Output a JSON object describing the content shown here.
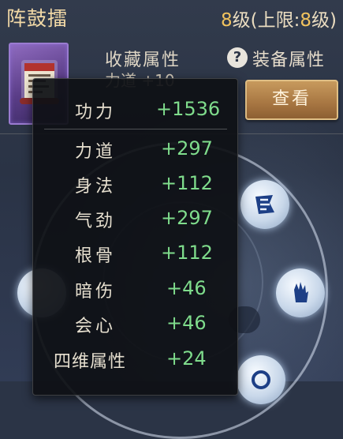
{
  "header": {
    "title": "阵鼓擂",
    "level_prefix": "8",
    "level_mid": "级(上限:",
    "level_max": "8",
    "level_suffix": "级)"
  },
  "item": {
    "collect_label": "收藏属性",
    "collect_partial": "力道 +10"
  },
  "actions": {
    "help_glyph": "?",
    "equip_label": "装备属性",
    "view_label": "查看"
  },
  "tooltip": {
    "header": {
      "label": "功力",
      "value": "+1536"
    },
    "rows": [
      {
        "label": "力道",
        "value": "+297"
      },
      {
        "label": "身法",
        "value": "+112"
      },
      {
        "label": "气劲",
        "value": "+297"
      },
      {
        "label": "根骨",
        "value": "+112"
      },
      {
        "label": "暗伤",
        "value": "+46"
      },
      {
        "label": "会心",
        "value": "+46"
      },
      {
        "label": "四维属性",
        "value": "+24"
      }
    ]
  },
  "colors": {
    "value_green": "#7fdc8c",
    "title_gold": "#f2d9a6",
    "level_gold": "#f1c25e"
  },
  "icons": [
    "item-scroll-icon",
    "help-icon",
    "skill-icon-top",
    "skill-icon-hand",
    "skill-icon-bottom"
  ]
}
